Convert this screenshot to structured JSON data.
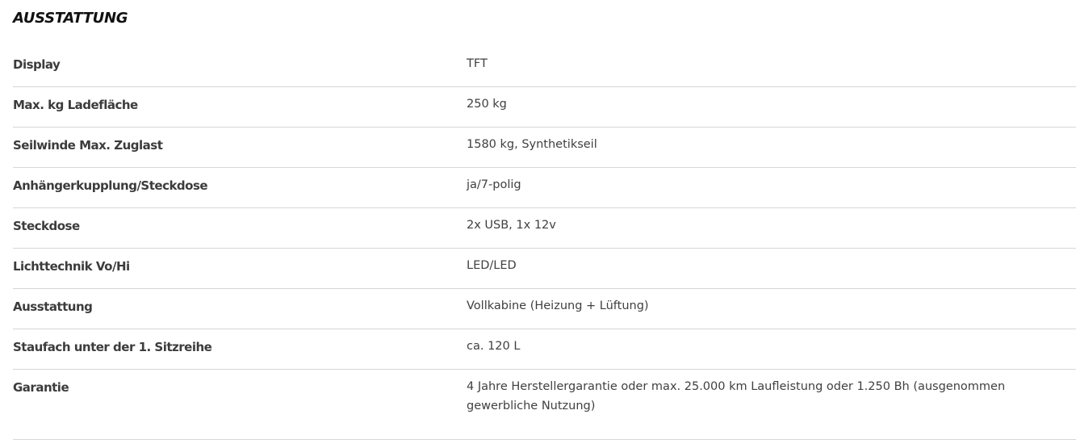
{
  "section": {
    "title": "AUSSTATTUNG"
  },
  "rows": [
    {
      "label": "Display",
      "value": "TFT"
    },
    {
      "label": "Max. kg Ladefläche",
      "value": "250 kg"
    },
    {
      "label": "Seilwinde Max. Zuglast",
      "value": "1580 kg, Synthetikseil"
    },
    {
      "label": "Anhängerkupplung/Steckdose",
      "value": "ja/7-polig"
    },
    {
      "label": "Steckdose",
      "value": "2x USB, 1x 12v"
    },
    {
      "label": "Lichttechnik Vo/Hi",
      "value": "LED/LED"
    },
    {
      "label": "Ausstattung",
      "value": "Vollkabine (Heizung + Lüftung)"
    },
    {
      "label": "Staufach unter der 1. Sitzreihe",
      "value": "ca. 120 L"
    },
    {
      "label": "Garantie",
      "value": "4 Jahre Herstellergarantie oder max. 25.000 km Laufleistung oder 1.250 Bh (ausgenommen gewerbliche Nutzung)"
    }
  ]
}
